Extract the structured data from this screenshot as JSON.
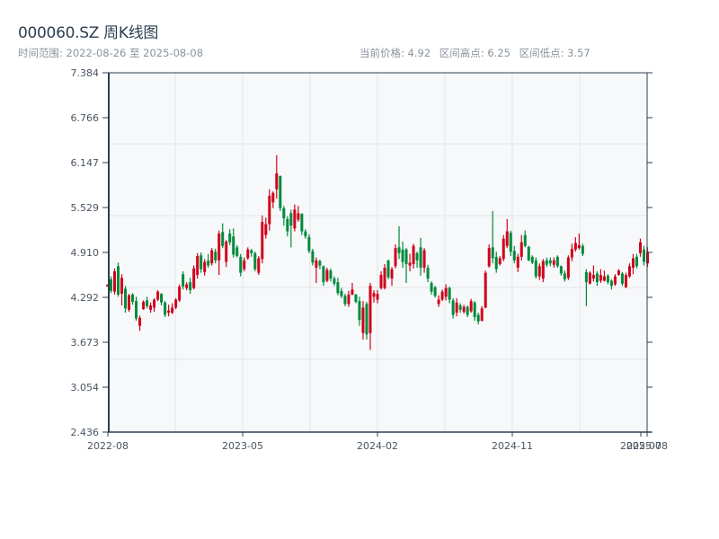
{
  "header": {
    "title": "000060.SZ 周K线图",
    "range_label": "时间范围: 2022-08-26 至 2025-08-08",
    "current_price": "当前价格: 4.92",
    "range_high": "区间高点: 6.25",
    "range_low": "区间低点: 3.57"
  },
  "chart_data": {
    "type": "candlestick",
    "title": "000060.SZ 周K线图",
    "xlabel": "",
    "ylabel": "",
    "ylim": [
      2.436,
      7.384
    ],
    "yticks": [
      "7.384",
      "6.766",
      "6.147",
      "5.529",
      "4.910",
      "4.292",
      "3.673",
      "3.054",
      "2.436"
    ],
    "xticks": [
      "2022-08",
      "2023-05",
      "2024-02",
      "2024-11",
      "2025-07",
      "2025-08"
    ],
    "grid": true,
    "colors": {
      "up": "#d0021b",
      "down": "#008a3a",
      "background": "#f6f8fa",
      "grid": "#e2e5ea",
      "axis": "#2c3e50"
    },
    "ohlc_fields": [
      "open",
      "high",
      "low",
      "close"
    ],
    "ohlc": [
      [
        4.44,
        4.47,
        4.44,
        4.46
      ],
      [
        4.54,
        4.58,
        4.35,
        4.38
      ],
      [
        4.37,
        4.69,
        4.33,
        4.65
      ],
      [
        4.72,
        4.77,
        4.3,
        4.33
      ],
      [
        4.34,
        4.61,
        4.18,
        4.56
      ],
      [
        4.41,
        4.45,
        4.08,
        4.14
      ],
      [
        4.12,
        4.34,
        4.09,
        4.32
      ],
      [
        4.33,
        4.35,
        4.19,
        4.23
      ],
      [
        4.24,
        4.3,
        3.97,
        4.0
      ],
      [
        3.9,
        4.04,
        3.83,
        4.01
      ],
      [
        4.13,
        4.25,
        4.12,
        4.23
      ],
      [
        4.25,
        4.3,
        4.14,
        4.17
      ],
      [
        4.12,
        4.22,
        4.08,
        4.18
      ],
      [
        4.15,
        4.28,
        4.09,
        4.26
      ],
      [
        4.26,
        4.39,
        4.24,
        4.37
      ],
      [
        4.34,
        4.35,
        4.18,
        4.22
      ],
      [
        4.22,
        4.24,
        4.02,
        4.05
      ],
      [
        4.08,
        4.19,
        4.03,
        4.11
      ],
      [
        4.08,
        4.21,
        4.06,
        4.15
      ],
      [
        4.15,
        4.28,
        4.13,
        4.26
      ],
      [
        4.25,
        4.47,
        4.23,
        4.44
      ],
      [
        4.61,
        4.65,
        4.4,
        4.44
      ],
      [
        4.42,
        4.5,
        4.39,
        4.47
      ],
      [
        4.5,
        4.56,
        4.34,
        4.39
      ],
      [
        4.42,
        4.73,
        4.4,
        4.69
      ],
      [
        4.6,
        4.9,
        4.55,
        4.86
      ],
      [
        4.87,
        4.91,
        4.63,
        4.68
      ],
      [
        4.64,
        4.82,
        4.59,
        4.78
      ],
      [
        4.8,
        4.89,
        4.7,
        4.73
      ],
      [
        4.76,
        4.97,
        4.73,
        4.94
      ],
      [
        4.92,
        4.96,
        4.76,
        4.8
      ],
      [
        4.8,
        5.21,
        4.6,
        5.17
      ],
      [
        5.19,
        5.31,
        4.97,
        5.0
      ],
      [
        4.78,
        5.08,
        4.71,
        5.06
      ],
      [
        5.17,
        5.23,
        5.01,
        5.05
      ],
      [
        5.13,
        5.24,
        4.84,
        4.88
      ],
      [
        4.98,
        5.01,
        4.84,
        4.86
      ],
      [
        4.85,
        4.89,
        4.58,
        4.63
      ],
      [
        4.68,
        4.84,
        4.65,
        4.8
      ],
      [
        4.83,
        4.98,
        4.81,
        4.95
      ],
      [
        4.94,
        4.96,
        4.85,
        4.9
      ],
      [
        4.9,
        4.92,
        4.65,
        4.68
      ],
      [
        4.63,
        4.86,
        4.6,
        4.83
      ],
      [
        4.82,
        5.42,
        4.76,
        5.33
      ],
      [
        5.15,
        5.39,
        5.1,
        5.3
      ],
      [
        5.3,
        5.78,
        5.21,
        5.69
      ],
      [
        5.6,
        5.75,
        5.52,
        5.73
      ],
      [
        5.78,
        6.25,
        5.65,
        6.0
      ],
      [
        5.96,
        5.97,
        5.48,
        5.52
      ],
      [
        5.52,
        5.55,
        5.28,
        5.38
      ],
      [
        5.37,
        5.41,
        5.13,
        5.2
      ],
      [
        5.45,
        5.5,
        4.98,
        5.28
      ],
      [
        5.24,
        5.57,
        5.2,
        5.5
      ],
      [
        5.36,
        5.55,
        5.33,
        5.45
      ],
      [
        5.44,
        5.45,
        5.15,
        5.2
      ],
      [
        5.2,
        5.23,
        5.1,
        5.13
      ],
      [
        5.12,
        5.16,
        4.9,
        4.93
      ],
      [
        4.93,
        4.96,
        4.73,
        4.77
      ],
      [
        4.7,
        4.84,
        4.49,
        4.8
      ],
      [
        4.79,
        4.81,
        4.68,
        4.73
      ],
      [
        4.72,
        4.73,
        4.45,
        4.5
      ],
      [
        4.52,
        4.7,
        4.5,
        4.67
      ],
      [
        4.66,
        4.69,
        4.51,
        4.55
      ],
      [
        4.55,
        4.58,
        4.45,
        4.48
      ],
      [
        4.5,
        4.56,
        4.32,
        4.35
      ],
      [
        4.38,
        4.42,
        4.28,
        4.31
      ],
      [
        4.31,
        4.34,
        4.17,
        4.2
      ],
      [
        4.2,
        4.38,
        4.16,
        4.33
      ],
      [
        4.33,
        4.49,
        4.32,
        4.4
      ],
      [
        4.33,
        4.34,
        4.21,
        4.23
      ],
      [
        4.24,
        4.3,
        3.9,
        3.98
      ],
      [
        3.8,
        4.24,
        3.71,
        4.15
      ],
      [
        4.2,
        4.23,
        3.71,
        3.78
      ],
      [
        3.8,
        4.49,
        3.57,
        4.45
      ],
      [
        4.3,
        4.39,
        4.22,
        4.35
      ],
      [
        4.26,
        4.39,
        4.21,
        4.34
      ],
      [
        4.42,
        4.65,
        4.4,
        4.6
      ],
      [
        4.42,
        4.75,
        4.4,
        4.7
      ],
      [
        4.8,
        4.81,
        4.54,
        4.57
      ],
      [
        4.55,
        4.71,
        4.45,
        4.68
      ],
      [
        4.72,
        5.02,
        4.69,
        4.97
      ],
      [
        4.98,
        5.27,
        4.82,
        4.9
      ],
      [
        4.95,
        5.06,
        4.7,
        4.78
      ],
      [
        4.95,
        4.97,
        4.49,
        4.75
      ],
      [
        4.73,
        4.89,
        4.65,
        4.77
      ],
      [
        4.75,
        5.03,
        4.69,
        5.0
      ],
      [
        4.9,
        4.92,
        4.7,
        4.8
      ],
      [
        4.98,
        5.11,
        4.59,
        4.7
      ],
      [
        4.7,
        4.97,
        4.63,
        4.94
      ],
      [
        4.7,
        4.74,
        4.5,
        4.55
      ],
      [
        4.49,
        4.51,
        4.33,
        4.37
      ],
      [
        4.43,
        4.45,
        4.29,
        4.31
      ],
      [
        4.2,
        4.32,
        4.16,
        4.26
      ],
      [
        4.26,
        4.4,
        4.24,
        4.37
      ],
      [
        4.3,
        4.47,
        4.25,
        4.42
      ],
      [
        4.42,
        4.44,
        4.21,
        4.26
      ],
      [
        4.25,
        4.28,
        4.0,
        4.05
      ],
      [
        4.08,
        4.28,
        4.03,
        4.22
      ],
      [
        4.18,
        4.21,
        4.08,
        4.12
      ],
      [
        4.09,
        4.19,
        4.07,
        4.16
      ],
      [
        4.16,
        4.18,
        4.02,
        4.05
      ],
      [
        4.1,
        4.27,
        4.08,
        4.24
      ],
      [
        4.22,
        4.24,
        3.97,
        4.02
      ],
      [
        4.05,
        4.08,
        3.92,
        3.96
      ],
      [
        3.97,
        4.17,
        3.96,
        4.14
      ],
      [
        4.15,
        4.66,
        4.14,
        4.63
      ],
      [
        4.72,
        5.02,
        4.7,
        4.97
      ],
      [
        4.98,
        5.48,
        4.76,
        4.83
      ],
      [
        4.85,
        4.92,
        4.63,
        4.68
      ],
      [
        4.75,
        4.86,
        4.73,
        4.83
      ],
      [
        4.82,
        5.15,
        4.79,
        5.1
      ],
      [
        5.0,
        5.37,
        4.97,
        5.2
      ],
      [
        5.18,
        5.21,
        4.86,
        4.92
      ],
      [
        4.93,
        5.0,
        4.76,
        4.8
      ],
      [
        4.7,
        4.89,
        4.64,
        4.85
      ],
      [
        4.85,
        5.15,
        4.8,
        5.05
      ],
      [
        5.15,
        5.21,
        4.98,
        5.0
      ],
      [
        4.99,
        5.0,
        4.79,
        4.8
      ],
      [
        4.85,
        4.87,
        4.75,
        4.77
      ],
      [
        4.8,
        4.84,
        4.55,
        4.58
      ],
      [
        4.58,
        4.76,
        4.53,
        4.72
      ],
      [
        4.55,
        4.82,
        4.5,
        4.79
      ],
      [
        4.8,
        4.84,
        4.71,
        4.74
      ],
      [
        4.8,
        4.84,
        4.72,
        4.76
      ],
      [
        4.74,
        4.84,
        4.7,
        4.8
      ],
      [
        4.85,
        4.87,
        4.7,
        4.72
      ],
      [
        4.72,
        4.73,
        4.59,
        4.62
      ],
      [
        4.62,
        4.66,
        4.51,
        4.54
      ],
      [
        4.56,
        4.87,
        4.53,
        4.84
      ],
      [
        4.84,
        5.03,
        4.79,
        4.96
      ],
      [
        4.95,
        5.12,
        4.92,
        5.04
      ],
      [
        4.97,
        5.17,
        4.95,
        5.01
      ],
      [
        5.0,
        5.03,
        4.86,
        4.89
      ],
      [
        4.64,
        4.68,
        4.17,
        4.5
      ],
      [
        4.48,
        4.65,
        4.47,
        4.63
      ],
      [
        4.55,
        4.73,
        4.51,
        4.6
      ],
      [
        4.62,
        4.65,
        4.45,
        4.5
      ],
      [
        4.52,
        4.68,
        4.49,
        4.6
      ],
      [
        4.52,
        4.66,
        4.51,
        4.58
      ],
      [
        4.59,
        4.61,
        4.47,
        4.5
      ],
      [
        4.52,
        4.54,
        4.4,
        4.45
      ],
      [
        4.47,
        4.61,
        4.45,
        4.58
      ],
      [
        4.6,
        4.68,
        4.59,
        4.66
      ],
      [
        4.62,
        4.64,
        4.45,
        4.48
      ],
      [
        4.43,
        4.63,
        4.42,
        4.6
      ],
      [
        4.58,
        4.76,
        4.56,
        4.72
      ],
      [
        4.7,
        4.89,
        4.61,
        4.83
      ],
      [
        4.85,
        4.89,
        4.69,
        4.72
      ],
      [
        4.9,
        5.1,
        4.85,
        5.05
      ],
      [
        4.95,
        5.0,
        4.73,
        4.78
      ],
      [
        4.76,
        4.98,
        4.71,
        4.92
      ]
    ]
  }
}
